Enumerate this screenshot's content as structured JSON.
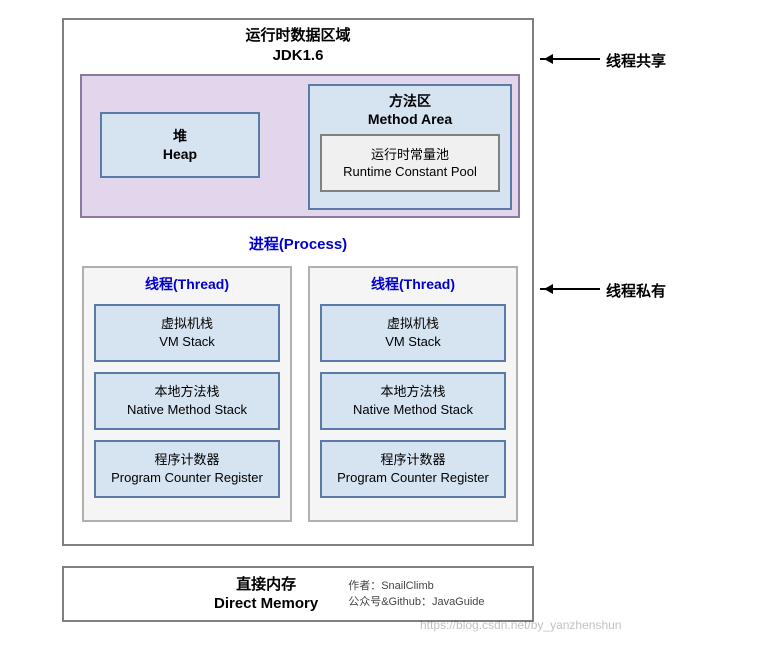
{
  "title": {
    "cn": "运行时数据区域",
    "sub": "JDK1.6"
  },
  "shared": {
    "heap": {
      "cn": "堆",
      "en": "Heap"
    },
    "methodArea": {
      "cn": "方法区",
      "en": "Method Area"
    },
    "rcp": {
      "cn": "运行时常量池",
      "en": "Runtime Constant Pool"
    }
  },
  "processLabel": "进程(Process)",
  "threadLabel": "线程(Thread)",
  "blocks": {
    "vmstack": {
      "cn": "虚拟机栈",
      "en": "VM Stack"
    },
    "native": {
      "cn": "本地方法栈",
      "en": "Native Method Stack"
    },
    "pcr": {
      "cn": "程序计数器",
      "en": "Program Counter Register"
    }
  },
  "directMemory": {
    "cn": "直接内存",
    "en": "Direct Memory"
  },
  "credits": {
    "author": "作者：SnailClimb",
    "pub": "公众号&Github：JavaGuide"
  },
  "sideLabels": {
    "shared": "线程共享",
    "private": "线程私有"
  },
  "watermark": "https://blog.csdn.net/by_yanzhenshun"
}
